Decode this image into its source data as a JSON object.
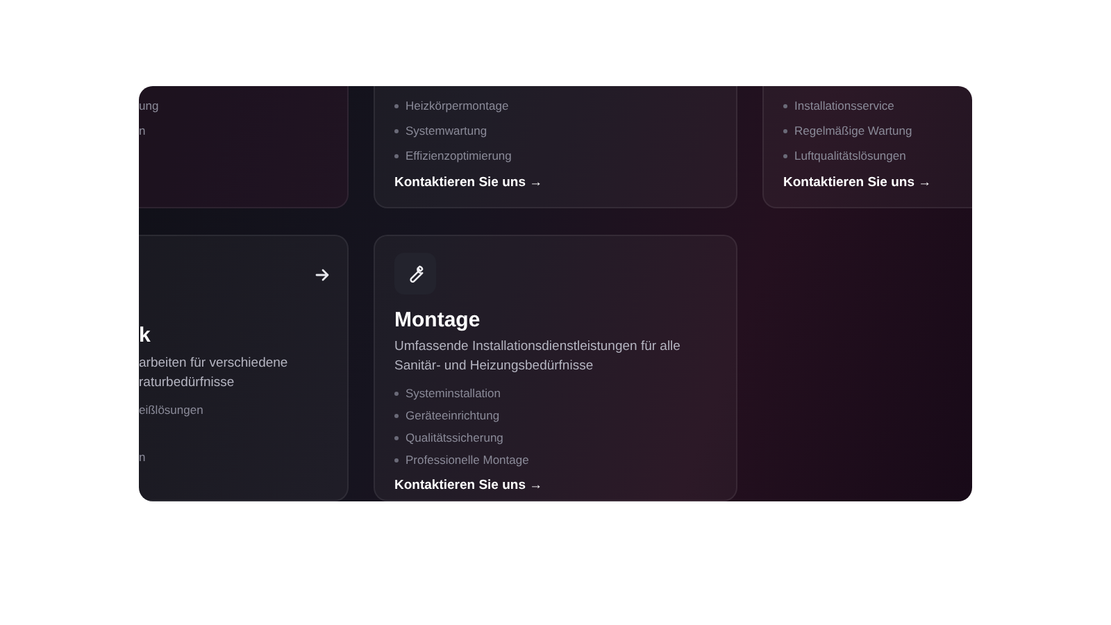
{
  "cards": [
    {
      "kind": "partial",
      "features": [
        "ung",
        "n"
      ]
    },
    {
      "kind": "full",
      "features": [
        "Heizkörpermontage",
        "Systemwartung",
        "Effizienzoptimierung"
      ],
      "link": "Kontaktieren Sie uns →"
    },
    {
      "kind": "full",
      "features": [
        "Installationsservice",
        "Regelmäßige Wartung",
        "Luftqualitätslösungen"
      ],
      "link": "Kontaktieren Sie uns →"
    },
    {
      "kind": "partial",
      "title": "k",
      "description_lines": [
        "arbeiten für verschiedene",
        "raturbedürfnisse"
      ],
      "features": [
        "eißlösungen",
        "n"
      ]
    },
    {
      "kind": "full",
      "title": "Montage",
      "description": "Umfassende Installationsdienstleistungen für alle Sanitär- und Heizungsbedürfnisse",
      "features": [
        "Systeminstallation",
        "Geräteeinrichtung",
        "Qualitätssicherung",
        "Professionelle Montage"
      ],
      "link": "Kontaktieren Sie uns →"
    }
  ]
}
